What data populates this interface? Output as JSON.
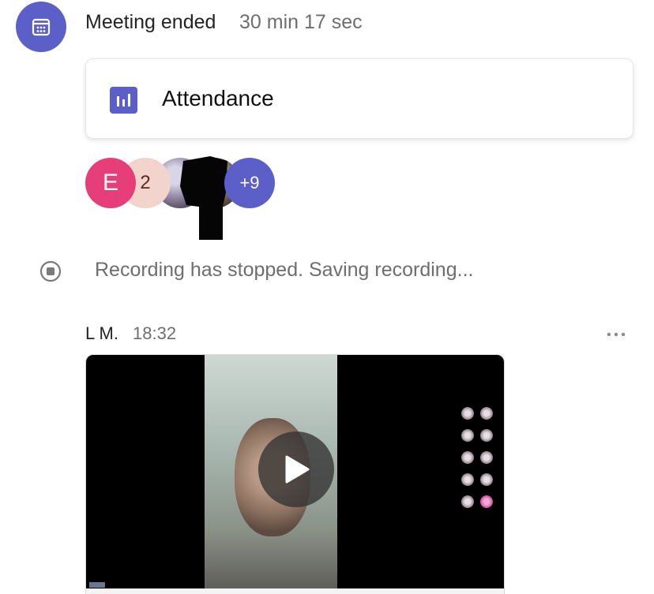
{
  "meeting": {
    "title": "Meeting ended",
    "duration": "30 min 17 sec",
    "icon": "calendar-icon"
  },
  "attendance": {
    "label": "Attendance",
    "icon": "bar-chart-icon"
  },
  "participants": {
    "avatars": [
      {
        "initial": "E",
        "color": "#e53e78"
      },
      {
        "initial": "2",
        "color": "#f3d4cc"
      }
    ],
    "more_count": "+9"
  },
  "recording": {
    "status": "Recording has stopped. Saving recording...",
    "icon": "stop-record-icon"
  },
  "message": {
    "sender": "L M.",
    "time": "18:32",
    "more_icon": "more-options-icon"
  },
  "video": {
    "play_icon": "play-icon"
  },
  "colors": {
    "accent": "#5b5fc7",
    "secondary_text": "#6e6e6e"
  }
}
